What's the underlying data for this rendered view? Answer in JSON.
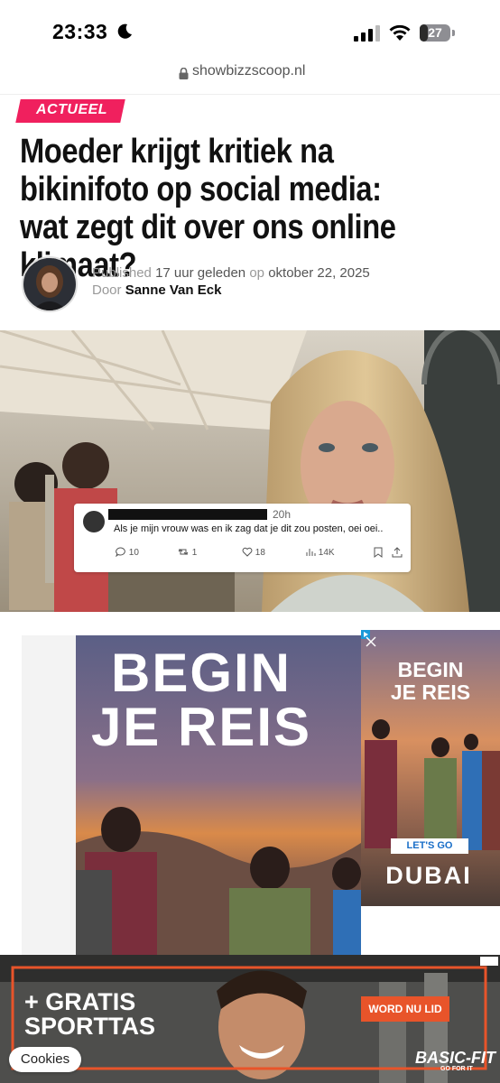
{
  "status_bar": {
    "time": "23:33",
    "battery": "27",
    "battery_level": 0.27
  },
  "browser": {
    "url": "showbizzscoop.nl"
  },
  "article": {
    "category": "ACTUEEL",
    "headline": "Moeder krijgt kritiek na bikinifoto op social media: wat zegt dit over ons online klimaat?",
    "published_label": "Published",
    "published_relative": "17 uur geleden",
    "published_on": "op",
    "published_date": "oktober 22, 2025",
    "author_prefix": "Door",
    "author": "Sanne Van Eck"
  },
  "tweet": {
    "time": "20h",
    "text": "Als je mijn vrouw was en ik zag dat je dit zou posten, oei oei..",
    "replies": "10",
    "retweets": "1",
    "likes": "18",
    "views": "14K"
  },
  "ad_travel": {
    "main_line1": "BEGIN",
    "main_line2": "JE REIS",
    "side_line1": "BEGIN",
    "side_line2": "JE REIS",
    "cta": "LET'S GO",
    "brand": "DUBAI"
  },
  "ad_gym": {
    "line1": "+ GRATIS",
    "line2": "SPORTTAS",
    "cta": "WORD NU LID",
    "brand": "BASIC-FIT",
    "brand_sub": "GO FOR IT"
  },
  "cookies": {
    "label": "Cookies"
  },
  "colors": {
    "accent": "#f0205e",
    "gym_cta": "#e8542a"
  }
}
